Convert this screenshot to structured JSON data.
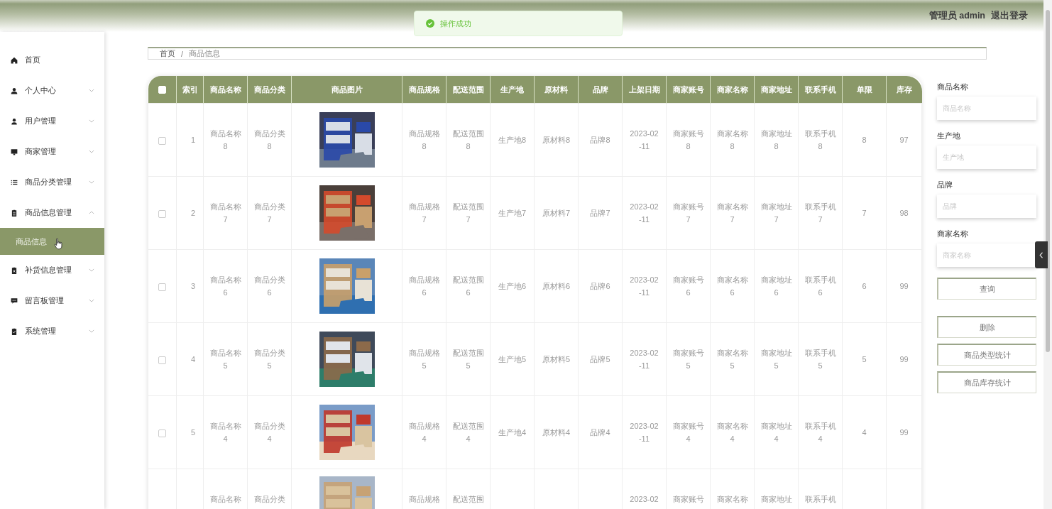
{
  "header": {
    "user": "管理员 admin",
    "logout": "退出登录"
  },
  "toast": {
    "text": "操作成功"
  },
  "sidebar": {
    "items": [
      {
        "label": "首页",
        "kind": "link"
      },
      {
        "label": "个人中心",
        "kind": "menu",
        "expanded": false
      },
      {
        "label": "用户管理",
        "kind": "menu",
        "expanded": false
      },
      {
        "label": "商家管理",
        "kind": "menu",
        "expanded": false
      },
      {
        "label": "商品分类管理",
        "kind": "menu",
        "expanded": false
      },
      {
        "label": "商品信息管理",
        "kind": "menu",
        "expanded": true,
        "children": [
          {
            "label": "商品信息",
            "selected": true
          }
        ]
      },
      {
        "label": "补货信息管理",
        "kind": "menu",
        "expanded": false
      },
      {
        "label": "留言板管理",
        "kind": "menu",
        "expanded": false
      },
      {
        "label": "系统管理",
        "kind": "menu",
        "expanded": false
      }
    ]
  },
  "breadcrumb": {
    "separator": "/",
    "items": [
      "首页",
      "商品信息"
    ]
  },
  "table": {
    "select_all_checked": false,
    "columns": [
      "索引",
      "商品名称",
      "商品分类",
      "商品图片",
      "商品规格",
      "配送范围",
      "生产地",
      "原材料",
      "品牌",
      "上架日期",
      "商家账号",
      "商家名称",
      "商家地址",
      "联系手机",
      "单限",
      "库存"
    ],
    "rows": [
      {
        "checked": false,
        "cut": false,
        "cells": [
          "1",
          "商品名称8",
          "商品分类8",
          {
            "kind": "picture"
          },
          "商品规格8",
          "配送范围8",
          "生产地8",
          "原材料8",
          "品牌8",
          "2023-02-11",
          "商家账号8",
          "商家名称8",
          "商家地址8",
          "联系手机8",
          "8",
          "97"
        ]
      },
      {
        "checked": false,
        "cut": false,
        "cells": [
          "2",
          "商品名称7",
          "商品分类7",
          {
            "kind": "picture"
          },
          "商品规格7",
          "配送范围7",
          "生产地7",
          "原材料7",
          "品牌7",
          "2023-02-11",
          "商家账号7",
          "商家名称7",
          "商家地址7",
          "联系手机7",
          "7",
          "98"
        ]
      },
      {
        "checked": false,
        "cut": false,
        "cells": [
          "3",
          "商品名称6",
          "商品分类6",
          {
            "kind": "picture"
          },
          "商品规格6",
          "配送范围6",
          "生产地6",
          "原材料6",
          "品牌6",
          "2023-02-11",
          "商家账号6",
          "商家名称6",
          "商家地址6",
          "联系手机6",
          "6",
          "99"
        ]
      },
      {
        "checked": false,
        "cut": false,
        "cells": [
          "4",
          "商品名称5",
          "商品分类5",
          {
            "kind": "picture"
          },
          "商品规格5",
          "配送范围5",
          "生产地5",
          "原材料5",
          "品牌5",
          "2023-02-11",
          "商家账号5",
          "商家名称5",
          "商家地址5",
          "联系手机5",
          "5",
          "99"
        ]
      },
      {
        "checked": false,
        "cut": false,
        "cells": [
          "5",
          "商品名称4",
          "商品分类4",
          {
            "kind": "picture"
          },
          "商品规格4",
          "配送范围4",
          "生产地4",
          "原材料4",
          "品牌4",
          "2023-02-11",
          "商家账号4",
          "商家名称4",
          "商家地址4",
          "联系手机4",
          "4",
          "99"
        ]
      },
      {
        "cut": true,
        "cells": [
          null,
          "商品名称",
          "商品分类",
          {
            "kind": "picture"
          },
          "商品规格",
          "配送范围",
          null,
          null,
          null,
          "2023-02",
          "商家账号",
          "商家名称",
          "商家地址",
          "联系手机",
          null,
          null
        ]
      }
    ]
  },
  "search_panel": {
    "fields": [
      {
        "label": "商品名称",
        "placeholder": "商品名称"
      },
      {
        "label": "生产地",
        "placeholder": "生产地"
      },
      {
        "label": "品牌",
        "placeholder": "品牌"
      },
      {
        "label": "商家名称",
        "placeholder": "商家名称"
      }
    ],
    "search_button": "查询",
    "actions": [
      "删除",
      "商品类型统计",
      "商品库存统计"
    ]
  }
}
